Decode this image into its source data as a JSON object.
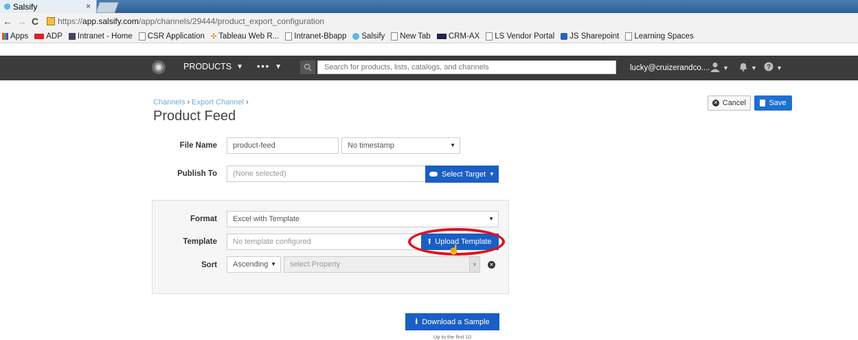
{
  "browser": {
    "tab_title": "Salsify",
    "tab_close": "×",
    "url_prefix": "https://",
    "url_host": "app.salsify.com",
    "url_path": "/app/channels/29444/product_export_configuration",
    "bookmarks": [
      {
        "label": "Apps",
        "icon": "apps-grid-icon"
      },
      {
        "label": "ADP",
        "icon": "adp-logo-icon"
      },
      {
        "label": "Intranet - Home",
        "icon": "ls-icon"
      },
      {
        "label": "CSR Application",
        "icon": "page-icon"
      },
      {
        "label": "Tableau Web R...",
        "icon": "tableau-icon"
      },
      {
        "label": "Intranet-Bbapp",
        "icon": "page-icon"
      },
      {
        "label": "Salsify",
        "icon": "salsify-icon"
      },
      {
        "label": "New Tab",
        "icon": "page-icon"
      },
      {
        "label": "CRM-AX",
        "icon": "crm-icon"
      },
      {
        "label": "LS Vendor Portal",
        "icon": "page-icon"
      },
      {
        "label": "JS Sharepoint",
        "icon": "sharepoint-icon"
      },
      {
        "label": "Learning Spaces",
        "icon": "page-icon"
      }
    ]
  },
  "header": {
    "products_label": "PRODUCTS",
    "more_label": "•••",
    "search_placeholder": "Search for products, lists, catalogs, and channels",
    "user_email": "lucky@cruizerandco...."
  },
  "breadcrumb": {
    "channels": "Channels",
    "export_channel": "Export Channel",
    "separator": "›"
  },
  "page": {
    "title": "Product Feed",
    "cancel_label": "Cancel",
    "save_label": "Save"
  },
  "form": {
    "file_name_label": "File Name",
    "file_name_value": "product-feed",
    "timestamp_value": "No timestamp",
    "publish_to_label": "Publish To",
    "publish_to_value": "(None selected)",
    "select_target_label": "Select Target",
    "format_label": "Format",
    "format_value": "Excel with Template",
    "template_label": "Template",
    "template_value": "No template configured",
    "upload_template_label": "Upload Template",
    "sort_label": "Sort",
    "sort_order_value": "Ascending",
    "sort_property_placeholder": "select Property"
  },
  "sample": {
    "download_label": "Download a Sample",
    "note": "Up to the first 10"
  },
  "colors": {
    "header_bg": "#3b3b3b",
    "primary_blue": "#1a5fc4",
    "highlight_red": "#e0101e",
    "breadcrumb_link": "#6aaed6"
  }
}
